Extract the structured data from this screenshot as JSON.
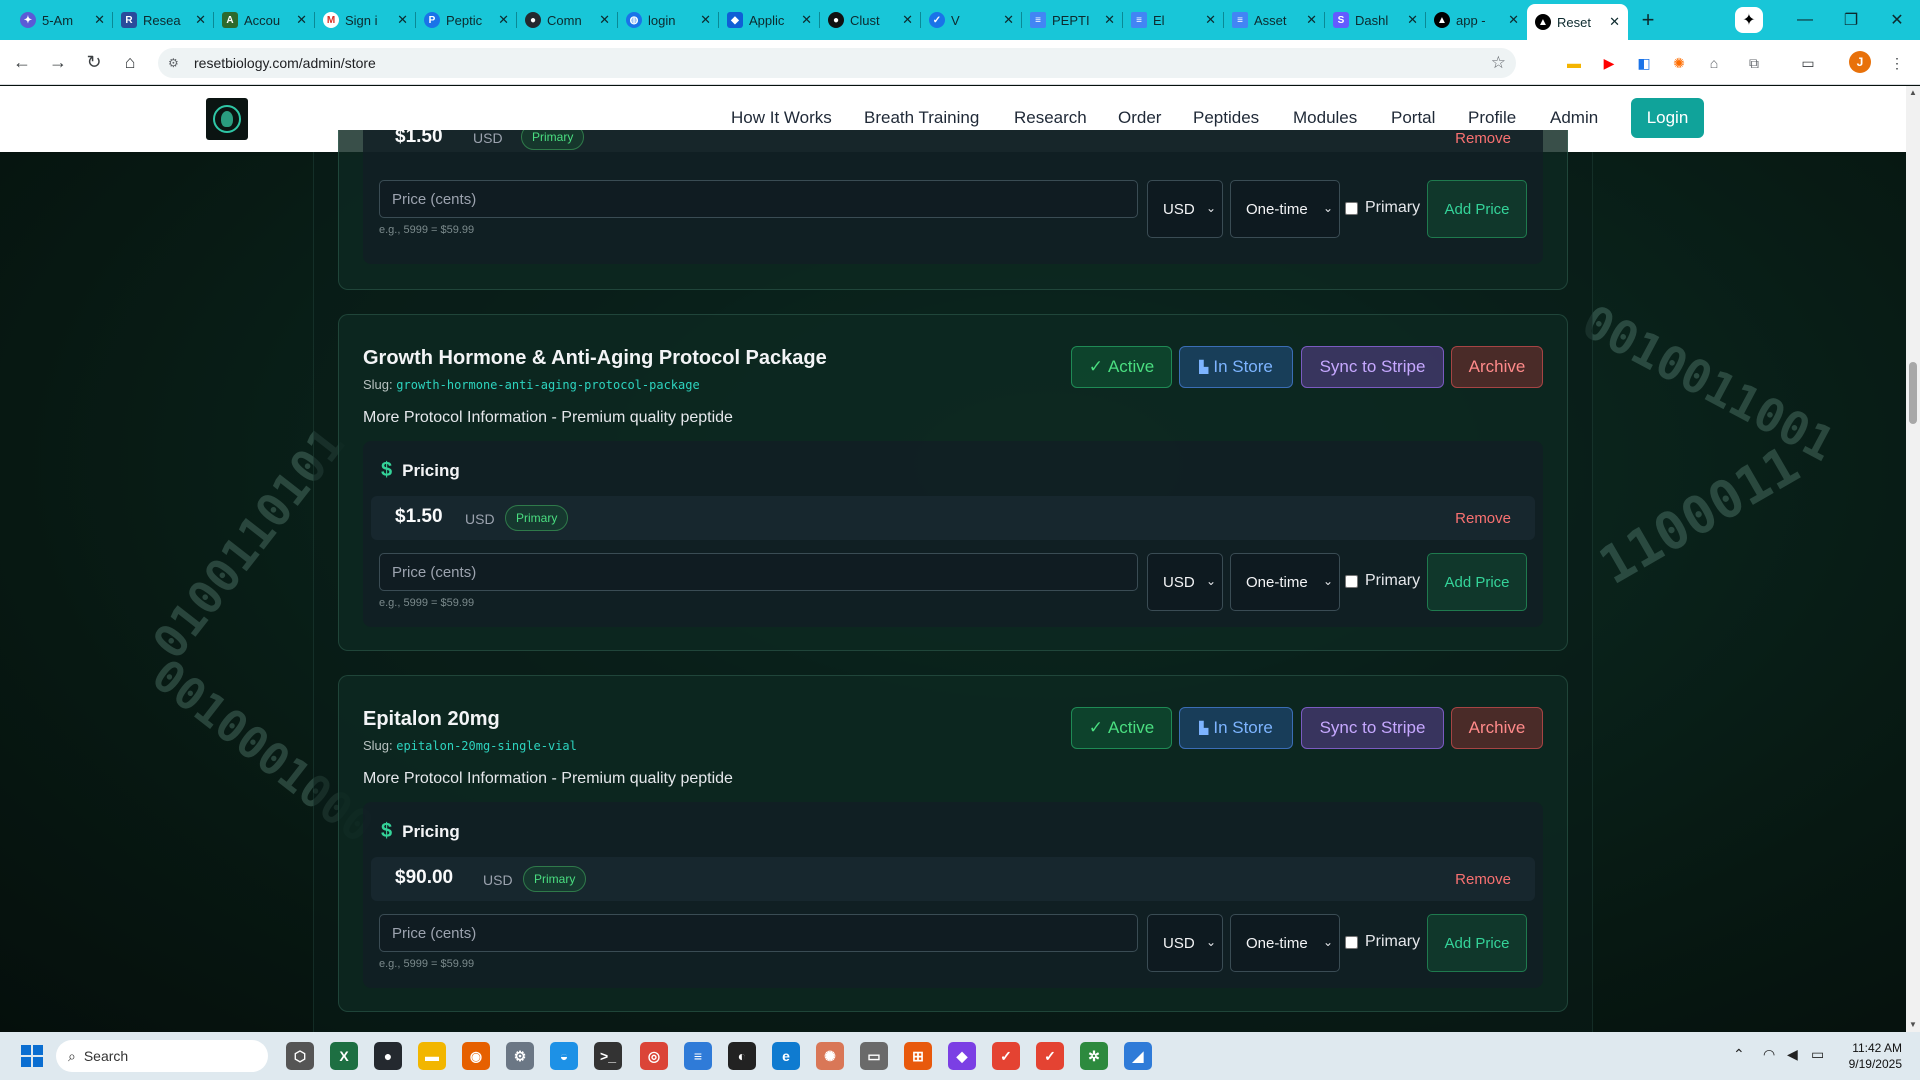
{
  "browser": {
    "tabs": [
      {
        "label": "5-Am",
        "icon": "purple-logo-icon",
        "color": "#5b5bd6"
      },
      {
        "label": "Resea",
        "icon": "research-icon",
        "color": "#2a4b9b"
      },
      {
        "label": "Accou",
        "icon": "account-icon",
        "color": "#2d6a2d"
      },
      {
        "label": "Sign i",
        "icon": "gmail-icon",
        "color": "#d93025"
      },
      {
        "label": "Peptic",
        "icon": "peptide-icon",
        "color": "#1a73e8"
      },
      {
        "label": "Comn",
        "icon": "github-icon",
        "color": "#24292f"
      },
      {
        "label": "login",
        "icon": "globe-icon",
        "color": "#1a73e8"
      },
      {
        "label": "Applic",
        "icon": "shield-icon",
        "color": "#0f5fd6"
      },
      {
        "label": "Clust",
        "icon": "cluster-icon",
        "color": "#111111"
      },
      {
        "label": "V",
        "icon": "check-icon",
        "color": "#1a73e8"
      },
      {
        "label": "PEPTI",
        "icon": "docs-icon",
        "color": "#4285f4"
      },
      {
        "label": "El",
        "icon": "docs-icon",
        "color": "#4285f4"
      },
      {
        "label": "Asset",
        "icon": "docs-icon",
        "color": "#4285f4"
      },
      {
        "label": "Dashl",
        "icon": "stripe-icon",
        "color": "#635bff"
      },
      {
        "label": "app -",
        "icon": "vercel-icon",
        "color": "#000000"
      },
      {
        "label": "Reset",
        "icon": "vercel-icon",
        "color": "#000000",
        "active": true
      }
    ],
    "url": "resetbiology.com/admin/store",
    "profile_initial": "J"
  },
  "site": {
    "nav": [
      "How It Works",
      "Breath Training",
      "Research",
      "Order",
      "Peptides",
      "Modules",
      "Portal",
      "Profile",
      "Admin"
    ],
    "login_label": "Login"
  },
  "buttons": {
    "active": "Active",
    "in_store": "In Store",
    "sync": "Sync to Stripe",
    "archive": "Archive"
  },
  "pricing_labels": {
    "heading": "Pricing",
    "primary_tag": "Primary",
    "remove": "Remove",
    "price_placeholder": "Price (cents)",
    "hint": "e.g., 5999 = $59.99",
    "currency": "USD",
    "interval": "One-time",
    "primary_checkbox": "Primary",
    "add_price": "Add Price"
  },
  "top_partial_card": {
    "amount": "$1.50",
    "currency": "USD",
    "tag": "Primary"
  },
  "products": [
    {
      "title": "Growth Hormone & Anti-Aging Protocol Package",
      "slug_label": "Slug:",
      "slug": "growth-hormone-anti-aging-protocol-package",
      "description": "More Protocol Information - Premium quality peptide",
      "price": {
        "amount": "$1.50",
        "currency": "USD"
      }
    },
    {
      "title": "Epitalon 20mg",
      "slug_label": "Slug:",
      "slug": "epitalon-20mg-single-vial",
      "description": "More Protocol Information - Premium quality peptide",
      "price": {
        "amount": "$90.00",
        "currency": "USD"
      }
    }
  ],
  "taskbar": {
    "search_label": "Search",
    "time": "11:42 AM",
    "date": "9/19/2025"
  }
}
